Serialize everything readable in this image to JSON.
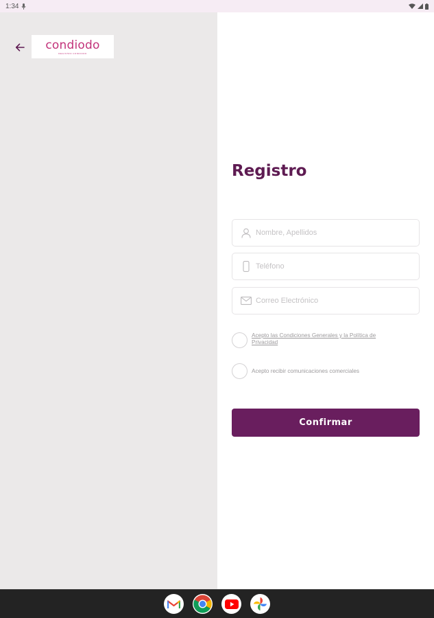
{
  "status_bar": {
    "time": "1:34"
  },
  "header": {
    "logo_text": "condiodo",
    "logo_subtext": "REGISTRO CONDIODO"
  },
  "form": {
    "title": "Registro",
    "name_placeholder": "Nombre, Apellidos",
    "phone_placeholder": "Teléfono",
    "email_placeholder": "Correo Electrónico",
    "terms_label": "Acepto las Condiciones Generales y la Política de Privacidad",
    "marketing_label": "Acepto recibir comunicaciones comerciales",
    "confirm_label": "Confirmar"
  },
  "taskbar": {
    "apps": [
      "gmail-icon",
      "chrome-icon",
      "youtube-icon",
      "photos-icon"
    ]
  },
  "colors": {
    "brand": "#691e5e",
    "title": "#5e1b52",
    "logo": "#c2327a",
    "left_panel": "#ebe9e9"
  }
}
